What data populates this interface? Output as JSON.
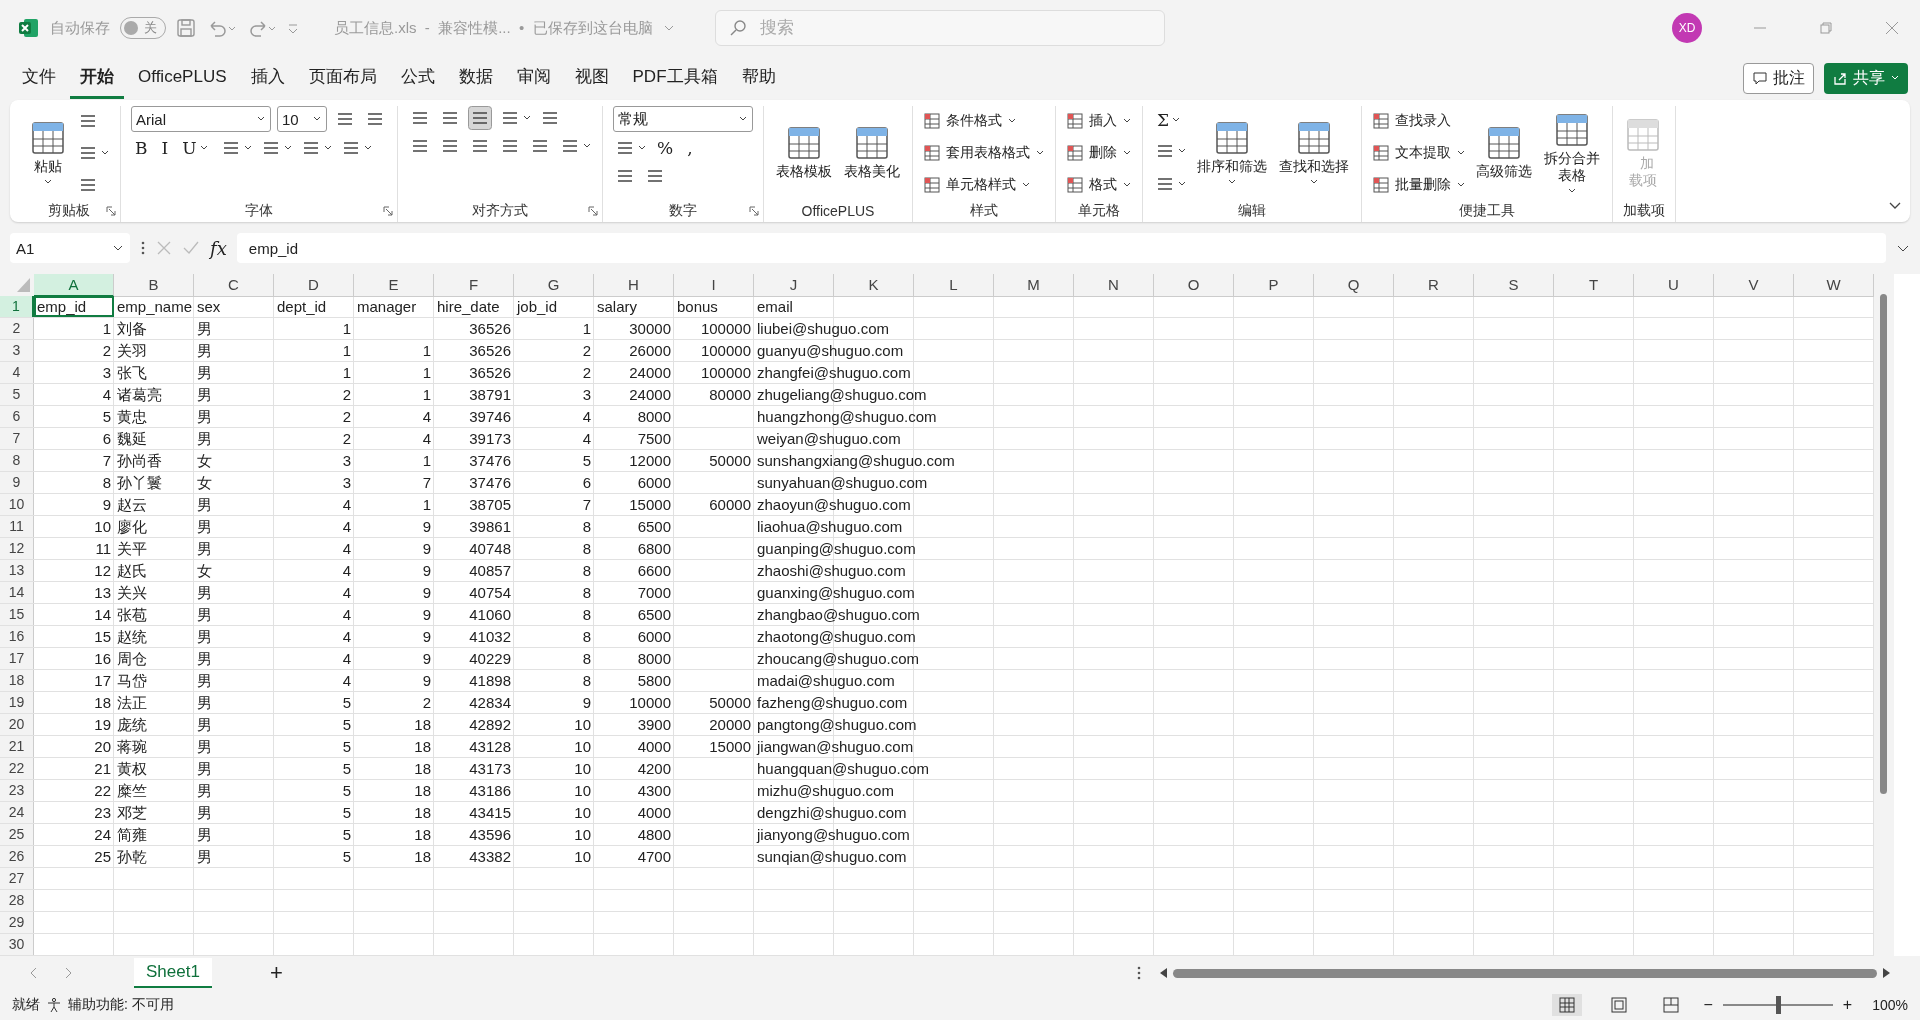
{
  "title_bar": {
    "autosave_label": "自动保存",
    "autosave": {
      "label": "关",
      "on": false
    },
    "title": "员工信息.xls  -  兼容性模...  •  已保存到这台电脑",
    "search": {
      "placeholder": "搜索"
    },
    "avatar": "XD"
  },
  "menu": {
    "tabs": [
      {
        "label": "文件",
        "selected": false
      },
      {
        "label": "开始",
        "selected": true
      },
      {
        "label": "OfficePLUS",
        "selected": false
      },
      {
        "label": "插入",
        "selected": false
      },
      {
        "label": "页面布局",
        "selected": false
      },
      {
        "label": "公式",
        "selected": false
      },
      {
        "label": "数据",
        "selected": false
      },
      {
        "label": "审阅",
        "selected": false
      },
      {
        "label": "视图",
        "selected": false
      },
      {
        "label": "PDF工具箱",
        "selected": false
      },
      {
        "label": "帮助",
        "selected": false
      }
    ],
    "comment_button": "批注",
    "share_button": "共享"
  },
  "ribbon": {
    "groups": [
      {
        "label": "剪贴板",
        "launcher": true,
        "kind": "columns",
        "lines": [
          [
            {
              "kind": "large",
              "label": "粘贴",
              "caret": true
            }
          ],
          [
            {
              "kind": "icon"
            },
            {
              "kind": "icon",
              "caret": true
            },
            {
              "kind": "icon"
            }
          ]
        ]
      },
      {
        "label": "字体",
        "launcher": true,
        "kind": "rows",
        "lines": [
          [
            {
              "kind": "field",
              "value": "Arial",
              "wide": true
            },
            {
              "kind": "field",
              "value": "10"
            },
            {
              "kind": "icon"
            },
            {
              "kind": "icon"
            }
          ],
          [
            {
              "kind": "glyph",
              "label": "B"
            },
            {
              "kind": "glyph",
              "label": "I"
            },
            {
              "kind": "glyph",
              "label": "U",
              "caret": true
            },
            {
              "kind": "icon",
              "caret": true
            },
            {
              "kind": "icon",
              "caret": true
            },
            {
              "kind": "icon",
              "caret": true
            },
            {
              "kind": "icon",
              "caret": true
            }
          ]
        ]
      },
      {
        "label": "对齐方式",
        "launcher": true,
        "kind": "rows",
        "lines": [
          [
            {
              "kind": "icon",
              "selected": false
            },
            {
              "kind": "icon",
              "selected": false
            },
            {
              "kind": "icon",
              "selected": true
            },
            {
              "kind": "icon",
              "caret": true
            },
            {
              "kind": "icon"
            }
          ],
          [
            {
              "kind": "icon"
            },
            {
              "kind": "icon"
            },
            {
              "kind": "icon"
            },
            {
              "kind": "icon"
            },
            {
              "kind": "icon"
            },
            {
              "kind": "icon",
              "caret": true
            }
          ]
        ]
      },
      {
        "label": "数字",
        "launcher": true,
        "kind": "rows",
        "lines": [
          [
            {
              "kind": "field",
              "value": "常规",
              "wide": true
            }
          ],
          [
            {
              "kind": "icon",
              "caret": true
            },
            {
              "kind": "glyph",
              "label": "%"
            },
            {
              "kind": "glyph",
              "label": ","
            }
          ],
          [
            {
              "kind": "icon"
            },
            {
              "kind": "icon"
            }
          ]
        ]
      },
      {
        "label": "OfficePLUS",
        "kind": "columns",
        "lines": [
          [
            {
              "kind": "large",
              "label": "表格模板"
            }
          ],
          [
            {
              "kind": "large",
              "label": "表格美化"
            }
          ]
        ]
      },
      {
        "label": "样式",
        "kind": "columns",
        "lines": [
          [
            {
              "kind": "small",
              "label": "条件格式",
              "caret": true
            },
            {
              "kind": "small",
              "label": "套用表格格式",
              "caret": true
            },
            {
              "kind": "small",
              "label": "单元格样式",
              "caret": true
            }
          ]
        ]
      },
      {
        "label": "单元格",
        "kind": "columns",
        "lines": [
          [
            {
              "kind": "small",
              "label": "插入",
              "caret": true
            },
            {
              "kind": "small",
              "label": "删除",
              "caret": true
            },
            {
              "kind": "small",
              "label": "格式",
              "caret": true
            }
          ]
        ]
      },
      {
        "label": "编辑",
        "kind": "columns",
        "lines": [
          [
            {
              "kind": "glyph",
              "label": "Σ",
              "caret": true
            },
            {
              "kind": "icon",
              "caret": true
            },
            {
              "kind": "icon",
              "caret": true
            }
          ],
          [
            {
              "kind": "large",
              "label": "排序和筛选",
              "caret": true
            }
          ],
          [
            {
              "kind": "large",
              "label": "查找和选择",
              "caret": true
            }
          ]
        ]
      },
      {
        "label": "便捷工具",
        "kind": "columns",
        "lines": [
          [
            {
              "kind": "small",
              "label": "查找录入"
            },
            {
              "kind": "small",
              "label": "文本提取",
              "caret": true
            },
            {
              "kind": "small",
              "label": "批量删除",
              "caret": true
            }
          ],
          [
            {
              "kind": "large",
              "label": "高级筛选"
            }
          ],
          [
            {
              "kind": "large",
              "label": "拆分合并表格",
              "caret": true,
              "narrow": true
            }
          ]
        ]
      },
      {
        "label": "加载项",
        "kind": "columns",
        "lines": [
          [
            {
              "kind": "large",
              "label": "加载项",
              "disabled": true,
              "narrow": true
            }
          ]
        ]
      }
    ]
  },
  "formula_bar": {
    "name_box": "A1",
    "fx": "fx",
    "value": "emp_id"
  },
  "sheet": {
    "columns": [
      {
        "label": "A",
        "selected": true,
        "numeric": true
      },
      {
        "label": "B",
        "selected": false,
        "numeric": false
      },
      {
        "label": "C",
        "selected": false,
        "numeric": false
      },
      {
        "label": "D",
        "selected": false,
        "numeric": true
      },
      {
        "label": "E",
        "selected": false,
        "numeric": true
      },
      {
        "label": "F",
        "selected": false,
        "numeric": true
      },
      {
        "label": "G",
        "selected": false,
        "numeric": true
      },
      {
        "label": "H",
        "selected": false,
        "numeric": true
      },
      {
        "label": "I",
        "selected": false,
        "numeric": true
      },
      {
        "label": "J",
        "selected": false,
        "numeric": false
      },
      {
        "label": "K",
        "selected": false
      },
      {
        "label": "L",
        "selected": false
      },
      {
        "label": "M",
        "selected": false
      },
      {
        "label": "N",
        "selected": false
      },
      {
        "label": "O",
        "selected": false
      },
      {
        "label": "P",
        "selected": false
      },
      {
        "label": "Q",
        "selected": false
      },
      {
        "label": "R",
        "selected": false
      },
      {
        "label": "S",
        "selected": false
      },
      {
        "label": "T",
        "selected": false
      },
      {
        "label": "U",
        "selected": false
      },
      {
        "label": "V",
        "selected": false
      },
      {
        "label": "W",
        "selected": false
      }
    ],
    "rows": [
      {
        "number": "1",
        "selected": true,
        "kind": "header",
        "cells": [
          "emp_id",
          "emp_name",
          "sex",
          "dept_id",
          "manager",
          "hire_date",
          "job_id",
          "salary",
          "bonus",
          "email"
        ]
      },
      {
        "number": "2",
        "selected": false,
        "kind": "data",
        "cells": [
          "1",
          "刘备",
          "男",
          "1",
          null,
          "36526",
          "1",
          "30000",
          "100000",
          "liubei@shuguo.com"
        ]
      },
      {
        "number": "3",
        "selected": false,
        "kind": "data",
        "cells": [
          "2",
          "关羽",
          "男",
          "1",
          "1",
          "36526",
          "2",
          "26000",
          "100000",
          "guanyu@shuguo.com"
        ]
      },
      {
        "number": "4",
        "selected": false,
        "kind": "data",
        "cells": [
          "3",
          "张飞",
          "男",
          "1",
          "1",
          "36526",
          "2",
          "24000",
          "100000",
          "zhangfei@shuguo.com"
        ]
      },
      {
        "number": "5",
        "selected": false,
        "kind": "data",
        "cells": [
          "4",
          "诸葛亮",
          "男",
          "2",
          "1",
          "38791",
          "3",
          "24000",
          "80000",
          "zhugeliang@shuguo.com"
        ]
      },
      {
        "number": "6",
        "selected": false,
        "kind": "data",
        "cells": [
          "5",
          "黄忠",
          "男",
          "2",
          "4",
          "39746",
          "4",
          "8000",
          null,
          "huangzhong@shuguo.com"
        ]
      },
      {
        "number": "7",
        "selected": false,
        "kind": "data",
        "cells": [
          "6",
          "魏延",
          "男",
          "2",
          "4",
          "39173",
          "4",
          "7500",
          null,
          "weiyan@shuguo.com"
        ]
      },
      {
        "number": "8",
        "selected": false,
        "kind": "data",
        "cells": [
          "7",
          "孙尚香",
          "女",
          "3",
          "1",
          "37476",
          "5",
          "12000",
          "50000",
          "sunshangxiang@shuguo.com"
        ]
      },
      {
        "number": "9",
        "selected": false,
        "kind": "data",
        "cells": [
          "8",
          "孙丫鬟",
          "女",
          "3",
          "7",
          "37476",
          "6",
          "6000",
          null,
          "sunyahuan@shuguo.com"
        ]
      },
      {
        "number": "10",
        "selected": false,
        "kind": "data",
        "cells": [
          "9",
          "赵云",
          "男",
          "4",
          "1",
          "38705",
          "7",
          "15000",
          "60000",
          "zhaoyun@shuguo.com"
        ]
      },
      {
        "number": "11",
        "selected": false,
        "kind": "data",
        "cells": [
          "10",
          "廖化",
          "男",
          "4",
          "9",
          "39861",
          "8",
          "6500",
          null,
          "liaohua@shuguo.com"
        ]
      },
      {
        "number": "12",
        "selected": false,
        "kind": "data",
        "cells": [
          "11",
          "关平",
          "男",
          "4",
          "9",
          "40748",
          "8",
          "6800",
          null,
          "guanping@shuguo.com"
        ]
      },
      {
        "number": "13",
        "selected": false,
        "kind": "data",
        "cells": [
          "12",
          "赵氏",
          "女",
          "4",
          "9",
          "40857",
          "8",
          "6600",
          null,
          "zhaoshi@shuguo.com"
        ]
      },
      {
        "number": "14",
        "selected": false,
        "kind": "data",
        "cells": [
          "13",
          "关兴",
          "男",
          "4",
          "9",
          "40754",
          "8",
          "7000",
          null,
          "guanxing@shuguo.com"
        ]
      },
      {
        "number": "15",
        "selected": false,
        "kind": "data",
        "cells": [
          "14",
          "张苞",
          "男",
          "4",
          "9",
          "41060",
          "8",
          "6500",
          null,
          "zhangbao@shuguo.com"
        ]
      },
      {
        "number": "16",
        "selected": false,
        "kind": "data",
        "cells": [
          "15",
          "赵统",
          "男",
          "4",
          "9",
          "41032",
          "8",
          "6000",
          null,
          "zhaotong@shuguo.com"
        ]
      },
      {
        "number": "17",
        "selected": false,
        "kind": "data",
        "cells": [
          "16",
          "周仓",
          "男",
          "4",
          "9",
          "40229",
          "8",
          "8000",
          null,
          "zhoucang@shuguo.com"
        ]
      },
      {
        "number": "18",
        "selected": false,
        "kind": "data",
        "cells": [
          "17",
          "马岱",
          "男",
          "4",
          "9",
          "41898",
          "8",
          "5800",
          null,
          "madai@shuguo.com"
        ]
      },
      {
        "number": "19",
        "selected": false,
        "kind": "data",
        "cells": [
          "18",
          "法正",
          "男",
          "5",
          "2",
          "42834",
          "9",
          "10000",
          "50000",
          "fazheng@shuguo.com"
        ]
      },
      {
        "number": "20",
        "selected": false,
        "kind": "data",
        "cells": [
          "19",
          "庞统",
          "男",
          "5",
          "18",
          "42892",
          "10",
          "3900",
          "20000",
          "pangtong@shuguo.com"
        ]
      },
      {
        "number": "21",
        "selected": false,
        "kind": "data",
        "cells": [
          "20",
          "蒋琬",
          "男",
          "5",
          "18",
          "43128",
          "10",
          "4000",
          "15000",
          "jiangwan@shuguo.com"
        ]
      },
      {
        "number": "22",
        "selected": false,
        "kind": "data",
        "cells": [
          "21",
          "黄权",
          "男",
          "5",
          "18",
          "43173",
          "10",
          "4200",
          null,
          "huangquan@shuguo.com"
        ]
      },
      {
        "number": "23",
        "selected": false,
        "kind": "data",
        "cells": [
          "22",
          "糜竺",
          "男",
          "5",
          "18",
          "43186",
          "10",
          "4300",
          null,
          "mizhu@shuguo.com"
        ]
      },
      {
        "number": "24",
        "selected": false,
        "kind": "data",
        "cells": [
          "23",
          "邓芝",
          "男",
          "5",
          "18",
          "43415",
          "10",
          "4000",
          null,
          "dengzhi@shuguo.com"
        ]
      },
      {
        "number": "25",
        "selected": false,
        "kind": "data",
        "cells": [
          "24",
          "简雍",
          "男",
          "5",
          "18",
          "43596",
          "10",
          "4800",
          null,
          "jianyong@shuguo.com"
        ]
      },
      {
        "number": "26",
        "selected": false,
        "kind": "data",
        "cells": [
          "25",
          "孙乾",
          "男",
          "5",
          "18",
          "43382",
          "10",
          "4700",
          null,
          "sunqian@shuguo.com"
        ]
      },
      {
        "number": "27",
        "selected": false
      },
      {
        "number": "28",
        "selected": false
      },
      {
        "number": "29",
        "selected": false
      },
      {
        "number": "30",
        "selected": false
      }
    ]
  },
  "sheet_tabs": {
    "tabs": [
      {
        "label": "Sheet1",
        "selected": true
      }
    ],
    "add": "+"
  },
  "status_bar": {
    "status": "就绪",
    "accessibility": "辅助功能: 不可用",
    "zoom_out": "−",
    "zoom_in": "+",
    "zoom": {
      "level": 0.5
    },
    "zoom_label": "100%"
  }
}
